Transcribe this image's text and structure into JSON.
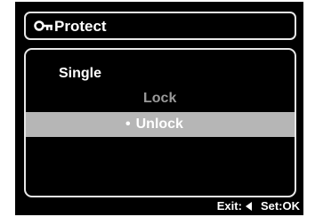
{
  "header": {
    "icon": "key-icon",
    "title": "Protect"
  },
  "menu": {
    "section_label": "Single",
    "options": [
      {
        "label": "Lock",
        "selected": false
      },
      {
        "label": "Unlock",
        "selected": true
      }
    ],
    "selected_bullet": "•"
  },
  "footer": {
    "exit_label": "Exit:",
    "exit_icon": "left-arrow-icon",
    "set_label": "Set:OK"
  },
  "colors": {
    "background": "#000000",
    "border": "#e8e8e8",
    "highlight": "#b6b6b6",
    "dim_text": "#9a9a9a",
    "text": "#ffffff"
  }
}
